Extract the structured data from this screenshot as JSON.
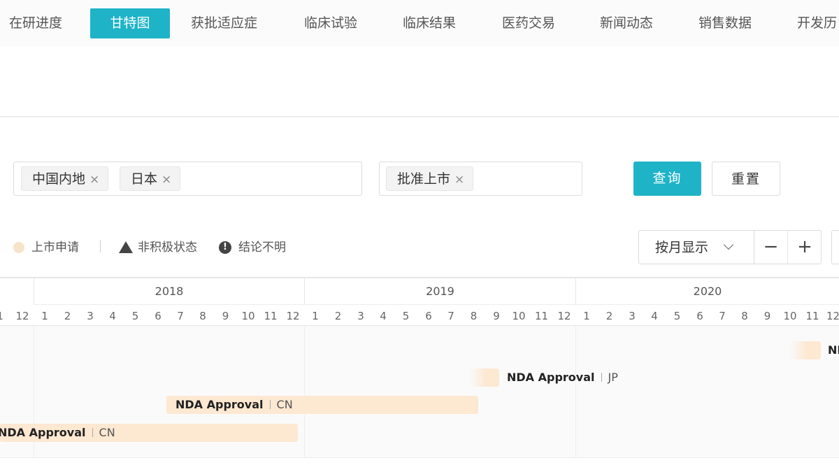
{
  "tabs": [
    {
      "label": "在研进度",
      "active": false
    },
    {
      "label": "甘特图",
      "active": true
    },
    {
      "label": "获批适应症",
      "active": false
    },
    {
      "label": "临床试验",
      "active": false
    },
    {
      "label": "临床结果",
      "active": false
    },
    {
      "label": "医药交易",
      "active": false
    },
    {
      "label": "新闻动态",
      "active": false
    },
    {
      "label": "销售数据",
      "active": false
    },
    {
      "label": "开发历",
      "active": false
    }
  ],
  "filters": {
    "region_chips": [
      "中国内地",
      "日本"
    ],
    "status_chips": [
      "批准上市"
    ],
    "remove_glyph": "×",
    "query_label": "查询",
    "reset_label": "重置"
  },
  "legend": {
    "items": [
      {
        "label": "上市申请",
        "icon": "dot-icon"
      },
      {
        "label": "非积极状态",
        "icon": "triangle-icon"
      },
      {
        "label": "结论不明",
        "icon": "exclamation-icon"
      }
    ],
    "warn_glyph": "!"
  },
  "toolbar": {
    "view_mode": "按月显示",
    "zoom_out": "−",
    "zoom_in": "+"
  },
  "gantt": {
    "years": [
      "2018",
      "2019",
      "2020"
    ],
    "months_before": [
      "1",
      "12"
    ],
    "months": [
      "1",
      "2",
      "3",
      "4",
      "5",
      "6",
      "7",
      "8",
      "9",
      "10",
      "11",
      "12"
    ],
    "bars": [
      {
        "name": "NDA Approval",
        "region": "CN"
      },
      {
        "name": "NDA Approval",
        "region": "CN"
      },
      {
        "name": "NDA Approval",
        "region": "JP"
      },
      {
        "name": "NI",
        "region": ""
      }
    ]
  },
  "colors": {
    "accent": "#1fb3c8",
    "bar_fill": "#fde8d2",
    "legend_dot": "#f7e4c8"
  }
}
